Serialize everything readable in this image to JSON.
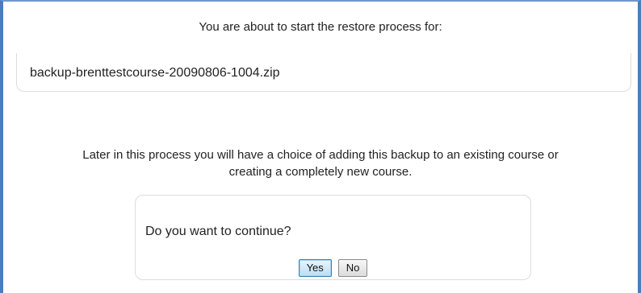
{
  "restore": {
    "heading": "You are about to start the restore process for:",
    "filename": "backup-brenttestcourse-20090806-1004.zip",
    "message_line1": "Later in this process you will have a choice of adding this backup to an existing course or",
    "message_line2": "creating a completely new course."
  },
  "confirm": {
    "question": "Do you want to continue?",
    "yes_label": "Yes",
    "no_label": "No"
  },
  "colors": {
    "frame_border": "#4a7ebb",
    "box_border": "#dddddd",
    "default_button": "#b9def5"
  }
}
